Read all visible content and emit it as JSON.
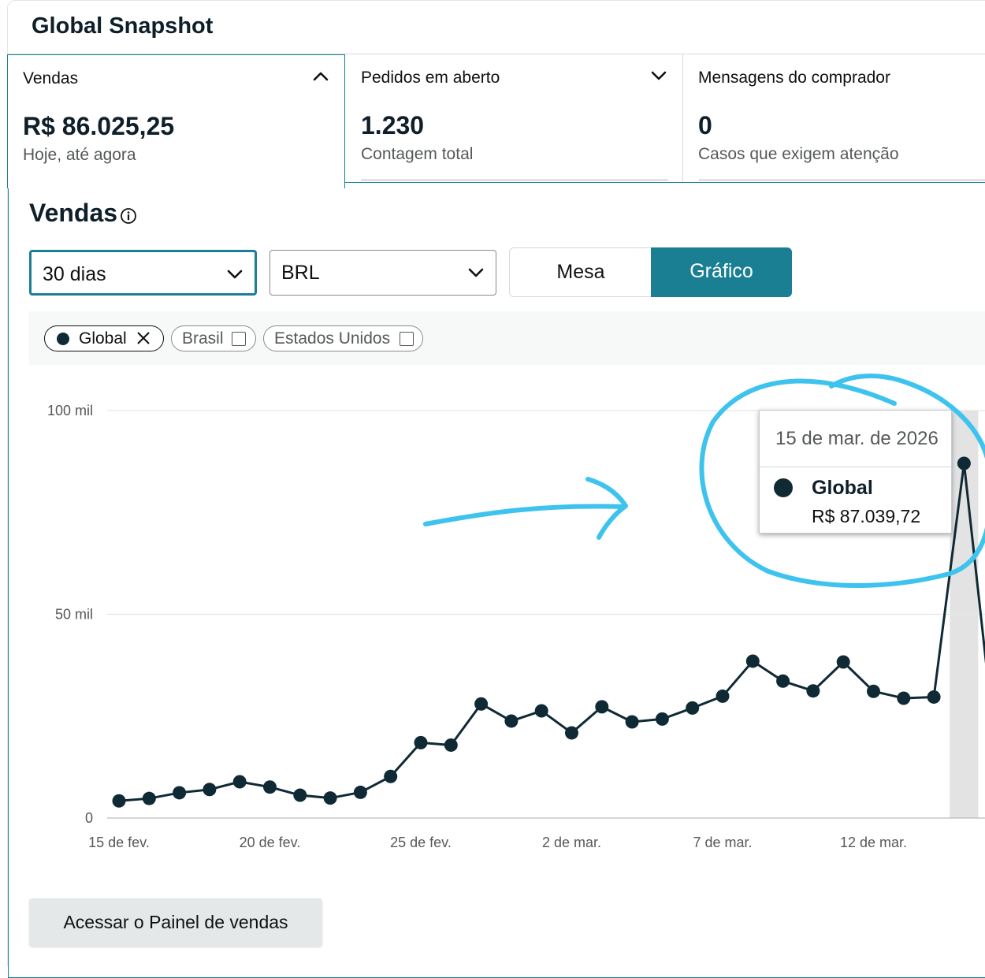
{
  "header": {
    "title": "Global Snapshot"
  },
  "cards": [
    {
      "label": "Vendas",
      "value": "R$ 86.025,25",
      "sub": "Hoje, até agora",
      "expanded": true
    },
    {
      "label": "Pedidos em aberto",
      "value": "1.230",
      "sub": "Contagem total",
      "expanded": false
    },
    {
      "label": "Mensagens do comprador",
      "value": "0",
      "sub": "Casos que exigem atenção"
    }
  ],
  "panel": {
    "title": "Vendas",
    "period_select": "30 dias",
    "currency_select": "BRL",
    "view_toggle": {
      "table_label": "Mesa",
      "chart_label": "Gráfico",
      "selected": "Gráfico"
    },
    "filters": [
      {
        "label": "Global",
        "selected": true
      },
      {
        "label": "Brasil",
        "selected": false
      },
      {
        "label": "Estados Unidos",
        "selected": false
      }
    ],
    "dashboard_button": "Acessar o Painel de vendas"
  },
  "tooltip": {
    "date": "15 de mar. de 2026",
    "series": "Global",
    "value": "R$ 87.039,72"
  },
  "colors": {
    "accent": "#1b7f94",
    "series": "#0f2a35",
    "annotation": "#3ec3ef"
  },
  "chart_data": {
    "type": "line",
    "y_tick_labels": [
      "0",
      "50 mil",
      "100 mil"
    ],
    "x_tick_labels": [
      "15 de fev.",
      "20 de fev.",
      "25 de fev.",
      "2 de mar.",
      "7 de mar.",
      "12 de mar."
    ],
    "ylim": [
      0,
      100000
    ],
    "grid": true,
    "series": [
      {
        "name": "Global",
        "values": [
          4200,
          4800,
          6200,
          7000,
          8900,
          7600,
          5600,
          4900,
          6300,
          10200,
          18500,
          17900,
          28000,
          23800,
          26300,
          20900,
          27300,
          23600,
          24300,
          27000,
          29900,
          38500,
          33600,
          31200,
          38300,
          31100,
          29400,
          29700,
          87039.72,
          20000
        ]
      }
    ],
    "highlighted_index": 28
  }
}
